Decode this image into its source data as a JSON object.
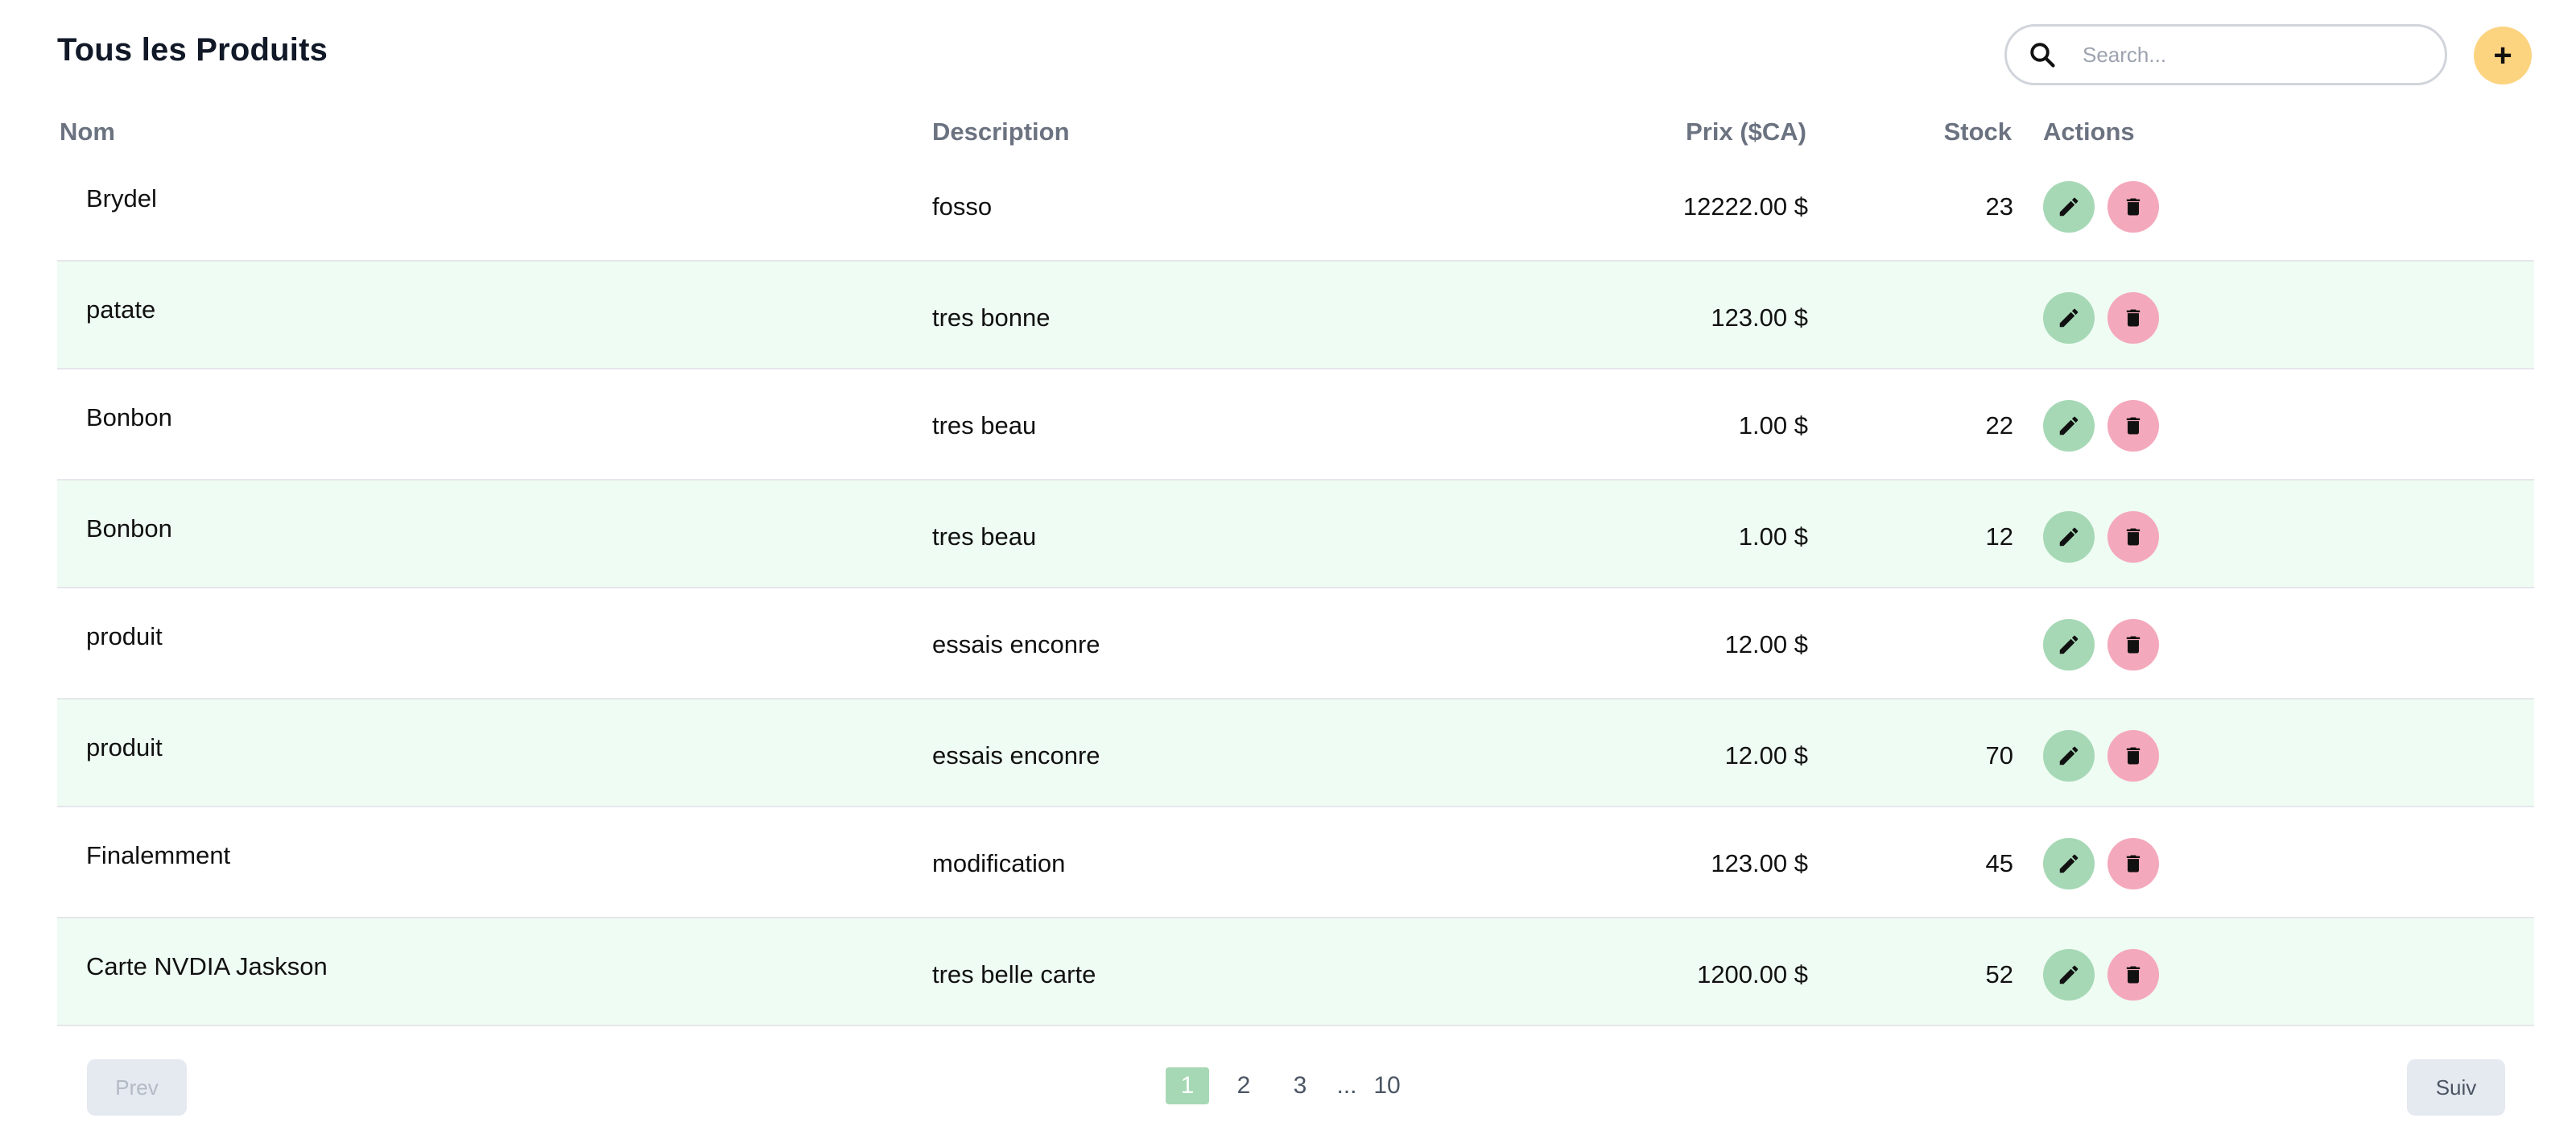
{
  "header": {
    "title": "Tous les Produits",
    "search_placeholder": "Search...",
    "search_icon": "search-icon",
    "add_label": "+"
  },
  "table": {
    "columns": {
      "name": "Nom",
      "description": "Description",
      "price": "Prix ($CA)",
      "stock": "Stock",
      "actions": "Actions"
    },
    "rows": [
      {
        "name": "Brydel",
        "description": "fosso",
        "price": "12222.00 $",
        "stock": "23"
      },
      {
        "name": "patate",
        "description": "tres bonne",
        "price": "123.00 $",
        "stock": ""
      },
      {
        "name": "Bonbon",
        "description": "tres beau",
        "price": "1.00 $",
        "stock": "22"
      },
      {
        "name": "Bonbon",
        "description": "tres beau",
        "price": "1.00 $",
        "stock": "12"
      },
      {
        "name": "produit",
        "description": "essais enconre",
        "price": "12.00 $",
        "stock": ""
      },
      {
        "name": "produit",
        "description": "essais enconre",
        "price": "12.00 $",
        "stock": "70"
      },
      {
        "name": "Finalemment",
        "description": "modification",
        "price": "123.00 $",
        "stock": "45"
      },
      {
        "name": "Carte NVDIA Jaskson",
        "description": "tres belle carte",
        "price": "1200.00 $",
        "stock": "52"
      }
    ],
    "action_icons": {
      "edit": "pencil-icon",
      "delete": "trash-icon"
    }
  },
  "pagination": {
    "prev_label": "Prev",
    "next_label": "Suiv",
    "pages": [
      "1",
      "2",
      "3",
      "...",
      "10"
    ],
    "current": "1"
  },
  "colors": {
    "accent_add": "#fcd480",
    "edit_button": "#a6d8b5",
    "delete_button": "#f4a8bb",
    "row_alt": "#effcf3",
    "active_page": "#a6d8b5"
  }
}
